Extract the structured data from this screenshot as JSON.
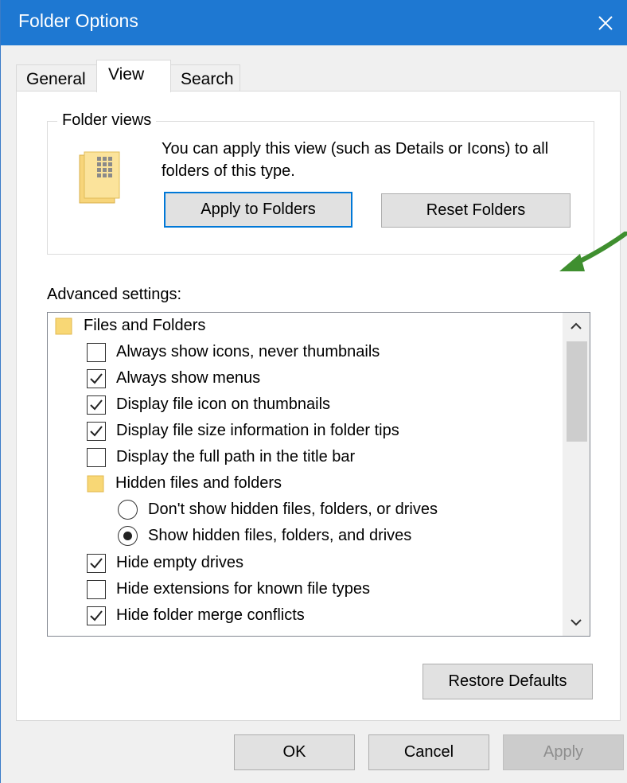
{
  "window": {
    "title": "Folder Options"
  },
  "tabs": [
    {
      "label": "General"
    },
    {
      "label": "View",
      "active": true
    },
    {
      "label": "Search"
    }
  ],
  "folder_views": {
    "legend": "Folder views",
    "description": "You can apply this view (such as Details or Icons) to all folders of this type.",
    "apply_label": "Apply to Folders",
    "reset_label": "Reset Folders"
  },
  "advanced": {
    "label": "Advanced settings:",
    "items": [
      {
        "type": "folder",
        "label": "Files and Folders"
      },
      {
        "type": "checkbox",
        "checked": false,
        "label": "Always show icons, never thumbnails"
      },
      {
        "type": "checkbox",
        "checked": true,
        "label": "Always show menus"
      },
      {
        "type": "checkbox",
        "checked": true,
        "label": "Display file icon on thumbnails"
      },
      {
        "type": "checkbox",
        "checked": true,
        "label": "Display file size information in folder tips"
      },
      {
        "type": "checkbox",
        "checked": false,
        "label": "Display the full path in the title bar"
      },
      {
        "type": "folder",
        "label": "Hidden files and folders"
      },
      {
        "type": "radio",
        "checked": false,
        "label": "Don't show hidden files, folders, or drives"
      },
      {
        "type": "radio",
        "checked": true,
        "label": "Show hidden files, folders, and drives"
      },
      {
        "type": "checkbox",
        "checked": true,
        "label": "Hide empty drives"
      },
      {
        "type": "checkbox",
        "checked": false,
        "label": "Hide extensions for known file types"
      },
      {
        "type": "checkbox",
        "checked": true,
        "label": "Hide folder merge conflicts"
      }
    ],
    "restore_label": "Restore Defaults"
  },
  "footer": {
    "ok_label": "OK",
    "cancel_label": "Cancel",
    "apply_label": "Apply"
  },
  "colors": {
    "titlebar": "#1e78d2",
    "accent": "#0078d7",
    "arrow": "#3f8f2f"
  },
  "icons": [
    "close-icon",
    "folder-view-icon",
    "folder-icon",
    "scroll-up-icon",
    "scroll-down-icon",
    "pointer-arrow-icon"
  ]
}
